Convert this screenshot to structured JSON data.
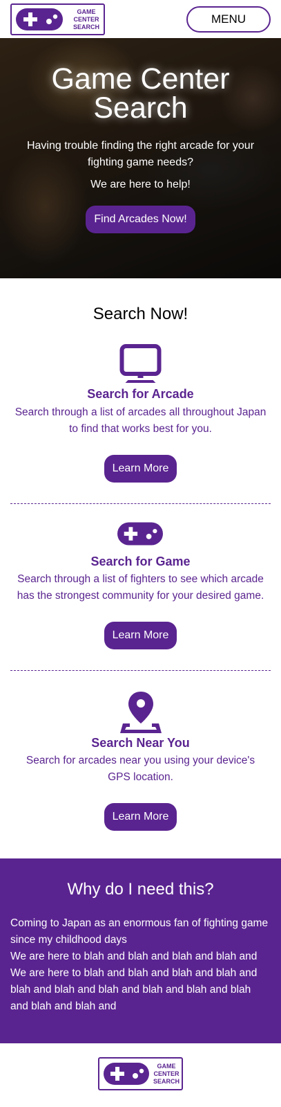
{
  "header": {
    "logo_lines": [
      "GAME",
      "CENTER",
      "SEARCH"
    ],
    "menu_label": "MENU"
  },
  "hero": {
    "title_line1": "Game Center",
    "title_line2": "Search",
    "subtitle": "Having trouble finding the right arcade for your fighting game needs?",
    "help_text": "We are here to help!",
    "cta_label": "Find Arcades Now!"
  },
  "search": {
    "title": "Search Now!",
    "features": [
      {
        "icon": "monitor-icon",
        "title": "Search for Arcade",
        "description": "Search through a list of arcades all throughout Japan to find that works best for you.",
        "button_label": "Learn More"
      },
      {
        "icon": "gamepad-icon",
        "title": "Search for Game",
        "description": "Search through a list of fighters to see which arcade has the strongest community for your desired game.",
        "button_label": "Learn More"
      },
      {
        "icon": "location-pin-icon",
        "title": "Search Near You",
        "description": "Search for arcades near you using your device's GPS location.",
        "button_label": "Learn More"
      }
    ]
  },
  "why": {
    "title": "Why do I need this?",
    "paragraph1": "Coming to Japan as an enormous fan of fighting game since my childhood days",
    "paragraph2": "We are here to blah and blah and blah and blah and We are here to blah and blah and blah and blah and blah and blah and blah and blah and blah and blah and blah and blah and"
  },
  "footer": {
    "logo_lines": [
      "GAME",
      "CENTER",
      "SEARCH"
    ]
  },
  "colors": {
    "brand_purple": "#5a2490",
    "white": "#ffffff"
  }
}
